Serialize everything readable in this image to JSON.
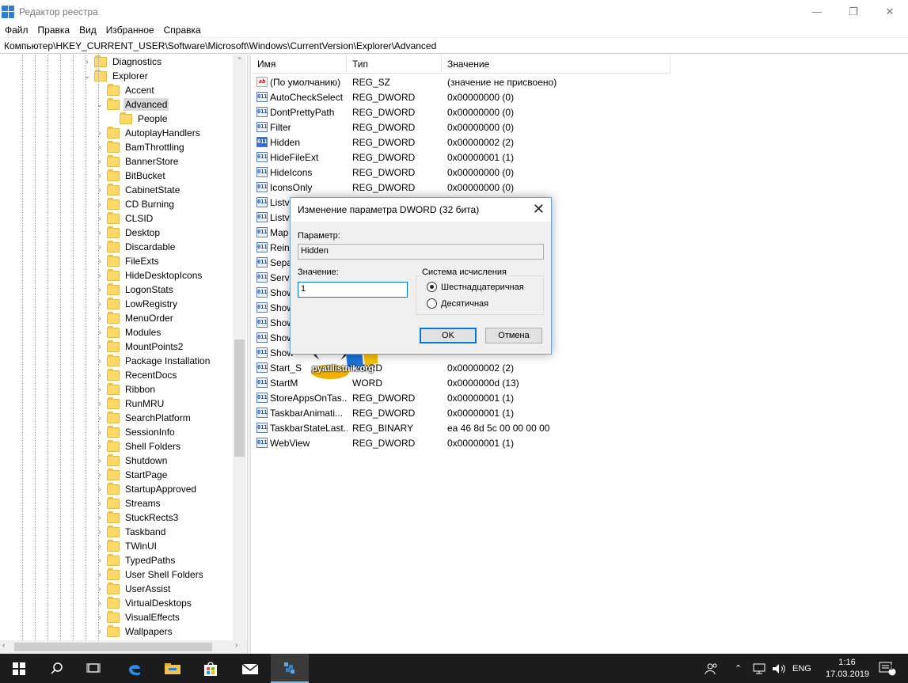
{
  "window": {
    "title": "Редактор реестра",
    "minimize": "—",
    "maximize": "❐",
    "close": "✕"
  },
  "menu": [
    "Файл",
    "Правка",
    "Вид",
    "Избранное",
    "Справка"
  ],
  "address": "Компьютер\\HKEY_CURRENT_USER\\Software\\Microsoft\\Windows\\CurrentVersion\\Explorer\\Advanced",
  "tree": {
    "parents": [
      "Diagnostics",
      "Explorer"
    ],
    "accent": "Accent",
    "selected": "Advanced",
    "child": "People",
    "items": [
      "AutoplayHandlers",
      "BamThrottling",
      "BannerStore",
      "BitBucket",
      "CabinetState",
      "CD Burning",
      "CLSID",
      "Desktop",
      "Discardable",
      "FileExts",
      "HideDesktopIcons",
      "LogonStats",
      "LowRegistry",
      "MenuOrder",
      "Modules",
      "MountPoints2",
      "Package Installation",
      "RecentDocs",
      "Ribbon",
      "RunMRU",
      "SearchPlatform",
      "SessionInfo",
      "Shell Folders",
      "Shutdown",
      "StartPage",
      "StartupApproved",
      "Streams",
      "StuckRects3",
      "Taskband",
      "TWinUI",
      "TypedPaths",
      "User Shell Folders",
      "UserAssist",
      "VirtualDesktops",
      "VisualEffects",
      "Wallpapers"
    ]
  },
  "list": {
    "columns": [
      "Имя",
      "Тип",
      "Значение"
    ],
    "rows": [
      {
        "name": "(По умолчанию)",
        "type": "REG_SZ",
        "value": "(значение не присвоено)",
        "icon": "ab"
      },
      {
        "name": "AutoCheckSelect",
        "type": "REG_DWORD",
        "value": "0x00000000 (0)",
        "icon": "011"
      },
      {
        "name": "DontPrettyPath",
        "type": "REG_DWORD",
        "value": "0x00000000 (0)",
        "icon": "011"
      },
      {
        "name": "Filter",
        "type": "REG_DWORD",
        "value": "0x00000000 (0)",
        "icon": "011"
      },
      {
        "name": "Hidden",
        "type": "REG_DWORD",
        "value": "0x00000002 (2)",
        "icon": "011"
      },
      {
        "name": "HideFileExt",
        "type": "REG_DWORD",
        "value": "0x00000001 (1)",
        "icon": "011"
      },
      {
        "name": "HideIcons",
        "type": "REG_DWORD",
        "value": "0x00000000 (0)",
        "icon": "011"
      },
      {
        "name": "IconsOnly",
        "type": "REG_DWORD",
        "value": "0x00000000 (0)",
        "icon": "011"
      },
      {
        "name": "Listv",
        "type": "",
        "value": "",
        "icon": "011"
      },
      {
        "name": "Listv",
        "type": "",
        "value": "",
        "icon": "011"
      },
      {
        "name": "Map",
        "type": "",
        "value": "",
        "icon": "011"
      },
      {
        "name": "Rein",
        "type": "",
        "value": "",
        "icon": "011"
      },
      {
        "name": "Sepa",
        "type": "",
        "value": "",
        "icon": "011"
      },
      {
        "name": "Serv",
        "type": "",
        "value": "",
        "icon": "011"
      },
      {
        "name": "Show",
        "type": "",
        "value": "",
        "icon": "011"
      },
      {
        "name": "Show",
        "type": "",
        "value": "",
        "icon": "011"
      },
      {
        "name": "Show",
        "type": "",
        "value": "",
        "icon": "011"
      },
      {
        "name": "Show",
        "type": "",
        "value": "",
        "icon": "011"
      },
      {
        "name": "Show",
        "type": "",
        "value": "",
        "icon": "011"
      },
      {
        "name": "Start_S",
        "type": "WORD",
        "value": "0x00000002 (2)",
        "icon": "011"
      },
      {
        "name": "StartM",
        "type": "WORD",
        "value": "0x0000000d (13)",
        "icon": "011"
      },
      {
        "name": "StoreAppsOnTas...",
        "type": "REG_DWORD",
        "value": "0x00000001 (1)",
        "icon": "011"
      },
      {
        "name": "TaskbarAnimati...",
        "type": "REG_DWORD",
        "value": "0x00000001 (1)",
        "icon": "011"
      },
      {
        "name": "TaskbarStateLast...",
        "type": "REG_BINARY",
        "value": "ea 46 8d 5c 00 00 00 00",
        "icon": "011"
      },
      {
        "name": "WebView",
        "type": "REG_DWORD",
        "value": "0x00000001 (1)",
        "icon": "011"
      }
    ]
  },
  "dialog": {
    "title": "Изменение параметра DWORD (32 бита)",
    "param_label": "Параметр:",
    "param_value": "Hidden",
    "value_label": "Значение:",
    "value": "1",
    "base_title": "Система исчисления",
    "hex": "Шестнадцатеричная",
    "dec": "Десятичная",
    "ok": "OK",
    "cancel": "Отмена"
  },
  "watermark": "pyatilistnik.org",
  "taskbar": {
    "lang": "ENG",
    "time": "1:16",
    "date": "17.03.2019",
    "notif_count": "3"
  },
  "colors": {
    "accent": "#0078d7",
    "taskbar": "#1c1c1c"
  }
}
